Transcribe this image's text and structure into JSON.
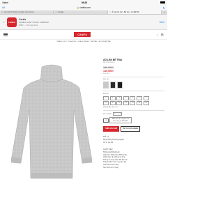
{
  "status": {
    "carrier": "Viettel",
    "time": "09:25",
    "battery": ""
  },
  "browser": {
    "aa": "AA",
    "url": "canifa.com",
    "tabs": [
      {
        "label": "Lam lại tết thuận lợi nhận của (Cloud...",
        "active": false
      },
      {
        "label": "Google",
        "active": false
      },
      {
        "label": "Áo len bé trai - Bé trai - Ưu đãi 50...",
        "active": true
      }
    ]
  },
  "app_banner": {
    "name": "Canifa",
    "company": "CANIFA JOINT STOCK COMPANY",
    "store": "MIỄN — Trên App Store",
    "open_label": "Xem",
    "logo_text": "CANIFA"
  },
  "site": {
    "brand": "CANIFA"
  },
  "breadcrumb": [
    "TRANG CHỦ",
    "/",
    "ƯU ĐÃI 50%",
    "/",
    "BLACK FRIDAY",
    "/",
    "BÉ TRAI",
    "/",
    "ÁO LEN BÉ TRAI"
  ],
  "product": {
    "title": "ÁO LEN BÉ TRAI",
    "sku": "Mã: 2TE18W074",
    "old_price": "299.000₫",
    "new_price": "149.500₫",
    "discount": "50% OFF",
    "color_label": "Màu sắc",
    "size_label": "Kích cỡ",
    "sizes": [
      "1",
      "2",
      "3",
      "4",
      "5",
      "6",
      "7",
      "8",
      "9",
      "10",
      "11",
      "12",
      "13",
      "14"
    ],
    "size_guide": "Hướng dẫn chọn size",
    "qty_label": "SỐ LƯỢNG",
    "qty_value": "1",
    "free_ship_count": "1",
    "free_ship_text": "Miễn phí vận chuyển cho đơn hàng từ 449.000₫",
    "add_to_cart": "THÊM VÀO GIỎ",
    "find_store": "TÌM TẠI CỬA HÀNG",
    "desc_head": "MÔ TẢ",
    "desc_lines": [
      "Dáng thẳng thường(regular)",
      "Cổ lọ, tay dài"
    ],
    "material_head": "CHẤT LIỆU",
    "material_lines": [
      "50%Cotton50%Acrylic",
      "Chất liệu: 50%cotton,50%acrylic",
      "Chất mềm, ấm không xù lông",
      "Không sử dụng hóa chất độc hại",
      "Không thấm nước, tay thon dài",
      "Chất vải có form đẹp",
      "Nên phơi nơi ít nắng"
    ]
  },
  "colors": {
    "accent": "#d7262d",
    "link": "#007aff"
  }
}
